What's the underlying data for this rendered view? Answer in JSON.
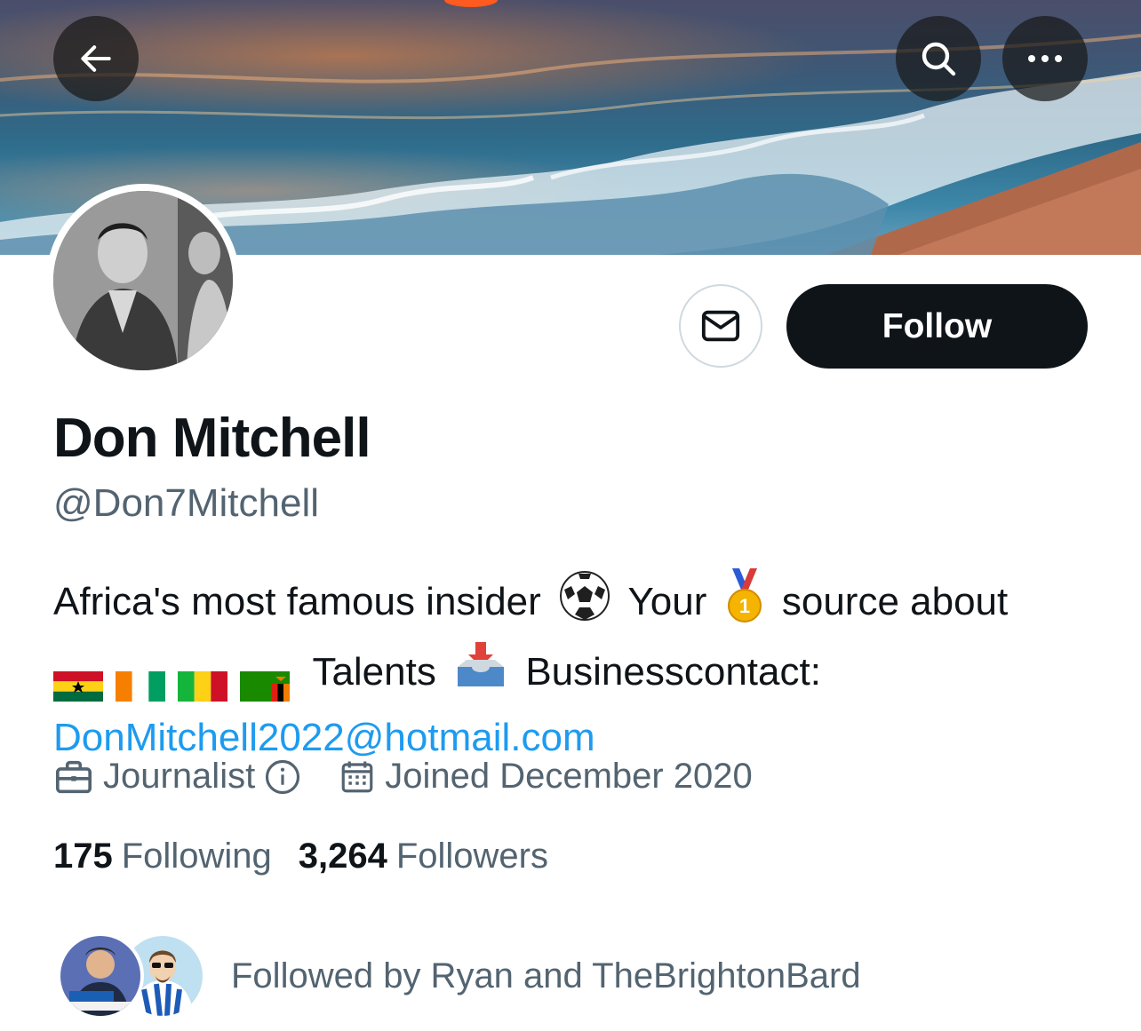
{
  "header": {
    "back_icon": "arrow-left-icon",
    "search_icon": "search-icon",
    "more_icon": "more-horizontal-icon"
  },
  "profile": {
    "display_name": "Don Mitchell",
    "handle": "@Don7Mitchell",
    "bio_line1_text1": "Africa's most famous insider",
    "bio_line1_text2": "Your",
    "bio_line1_text3": "source about",
    "bio_line2_text1": "Talents",
    "bio_line2_text2": "Businesscontact:",
    "bio_email": "DonMitchell2022@hotmail.com",
    "profession": "Journalist",
    "joined": "Joined December 2020",
    "following_count": "175",
    "following_label": "Following",
    "followers_count": "3,264",
    "followers_label": "Followers",
    "followed_by": "Followed by Ryan and TheBrightonBard"
  },
  "actions": {
    "follow_label": "Follow",
    "message_icon": "envelope-icon"
  },
  "colors": {
    "accent_link": "#1d9bf0",
    "primary_text": "#0f1419",
    "secondary_text": "#536471",
    "follow_button_bg": "#0f1419"
  }
}
